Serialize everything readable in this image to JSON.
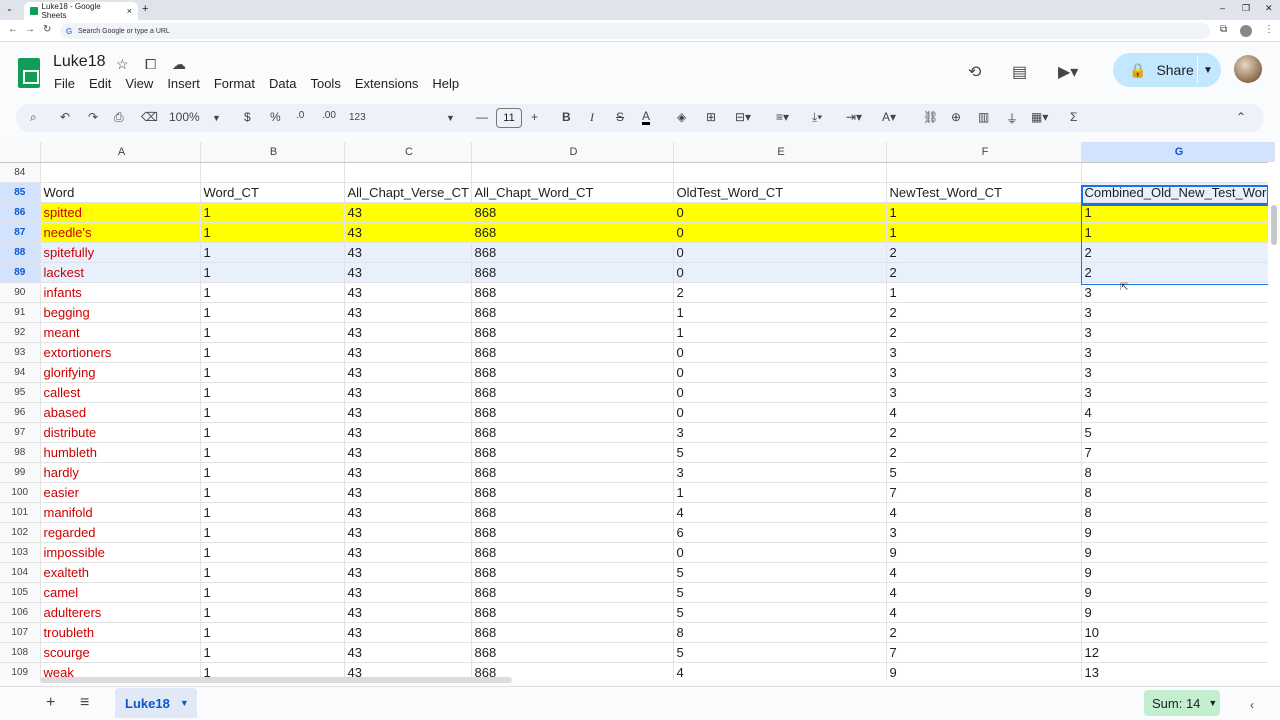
{
  "browser": {
    "tab_title": "Luke18 - Google Sheets",
    "tab_close": "×",
    "new_tab": "+",
    "address_placeholder": "Search Google or type a URL"
  },
  "doc": {
    "title": "Luke18",
    "menu": [
      "File",
      "Edit",
      "View",
      "Insert",
      "Format",
      "Data",
      "Tools",
      "Extensions",
      "Help"
    ],
    "share_label": "Share"
  },
  "toolbar": {
    "zoom": "100%",
    "currency": "$",
    "percent": "%",
    "dec_decrease": ".0",
    "dec_increase": ".00",
    "number_format": "123",
    "font_size": "11",
    "bold": "B",
    "italic": "I"
  },
  "grid": {
    "columns": [
      "A",
      "B",
      "C",
      "D",
      "E",
      "F",
      "G"
    ],
    "rows": [
      {
        "n": "84",
        "cells": [
          "",
          "",
          "",
          "",
          "",
          "",
          ""
        ]
      },
      {
        "n": "85",
        "cells": [
          "Word",
          "Word_CT",
          "All_Chapt_Verse_CT",
          "All_Chapt_Word_CT",
          "OldTest_Word_CT",
          "NewTest_Word_CT",
          "Combined_Old_New_Test_Word"
        ]
      },
      {
        "n": "86",
        "cells": [
          "spitted",
          "1",
          "43",
          "868",
          "0",
          "1",
          "1"
        ]
      },
      {
        "n": "87",
        "cells": [
          "needle's",
          "1",
          "43",
          "868",
          "0",
          "1",
          "1"
        ]
      },
      {
        "n": "88",
        "cells": [
          "spitefully",
          "1",
          "43",
          "868",
          "0",
          "2",
          "2"
        ]
      },
      {
        "n": "89",
        "cells": [
          "lackest",
          "1",
          "43",
          "868",
          "0",
          "2",
          "2"
        ]
      },
      {
        "n": "90",
        "cells": [
          "infants",
          "1",
          "43",
          "868",
          "2",
          "1",
          "3"
        ]
      },
      {
        "n": "91",
        "cells": [
          "begging",
          "1",
          "43",
          "868",
          "1",
          "2",
          "3"
        ]
      },
      {
        "n": "92",
        "cells": [
          "meant",
          "1",
          "43",
          "868",
          "1",
          "2",
          "3"
        ]
      },
      {
        "n": "93",
        "cells": [
          "extortioners",
          "1",
          "43",
          "868",
          "0",
          "3",
          "3"
        ]
      },
      {
        "n": "94",
        "cells": [
          "glorifying",
          "1",
          "43",
          "868",
          "0",
          "3",
          "3"
        ]
      },
      {
        "n": "95",
        "cells": [
          "callest",
          "1",
          "43",
          "868",
          "0",
          "3",
          "3"
        ]
      },
      {
        "n": "96",
        "cells": [
          "abased",
          "1",
          "43",
          "868",
          "0",
          "4",
          "4"
        ]
      },
      {
        "n": "97",
        "cells": [
          "distribute",
          "1",
          "43",
          "868",
          "3",
          "2",
          "5"
        ]
      },
      {
        "n": "98",
        "cells": [
          "humbleth",
          "1",
          "43",
          "868",
          "5",
          "2",
          "7"
        ]
      },
      {
        "n": "99",
        "cells": [
          "hardly",
          "1",
          "43",
          "868",
          "3",
          "5",
          "8"
        ]
      },
      {
        "n": "100",
        "cells": [
          "easier",
          "1",
          "43",
          "868",
          "1",
          "7",
          "8"
        ]
      },
      {
        "n": "101",
        "cells": [
          "manifold",
          "1",
          "43",
          "868",
          "4",
          "4",
          "8"
        ]
      },
      {
        "n": "102",
        "cells": [
          "regarded",
          "1",
          "43",
          "868",
          "6",
          "3",
          "9"
        ]
      },
      {
        "n": "103",
        "cells": [
          "impossible",
          "1",
          "43",
          "868",
          "0",
          "9",
          "9"
        ]
      },
      {
        "n": "104",
        "cells": [
          "exalteth",
          "1",
          "43",
          "868",
          "5",
          "4",
          "9"
        ]
      },
      {
        "n": "105",
        "cells": [
          "camel",
          "1",
          "43",
          "868",
          "5",
          "4",
          "9"
        ]
      },
      {
        "n": "106",
        "cells": [
          "adulterers",
          "1",
          "43",
          "868",
          "5",
          "4",
          "9"
        ]
      },
      {
        "n": "107",
        "cells": [
          "troubleth",
          "1",
          "43",
          "868",
          "8",
          "2",
          "10"
        ]
      },
      {
        "n": "108",
        "cells": [
          "scourge",
          "1",
          "43",
          "868",
          "5",
          "7",
          "12"
        ]
      },
      {
        "n": "109",
        "cells": [
          "weak",
          "1",
          "43",
          "868",
          "4",
          "9",
          "13"
        ]
      }
    ]
  },
  "footer": {
    "sheet_name": "Luke18",
    "sum_label": "Sum: 14"
  },
  "colors": {
    "highlight": "#ffff00",
    "word_text": "#cc0000",
    "selection": "#1a73e8",
    "share_bg": "#c2e7ff"
  }
}
